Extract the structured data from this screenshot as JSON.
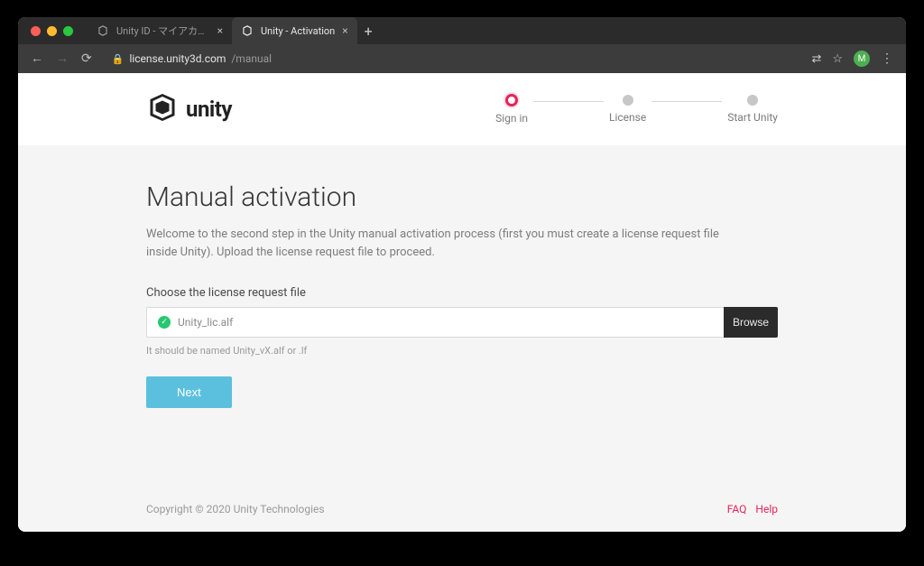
{
  "browser": {
    "tabs": [
      {
        "label": "Unity ID - マイアカウント設定",
        "active": false
      },
      {
        "label": "Unity - Activation",
        "active": true
      }
    ],
    "url_host": "license.unity3d.com",
    "url_path": "/manual",
    "avatar_initial": "M"
  },
  "header": {
    "brand": "unity",
    "steps": [
      {
        "label": "Sign in",
        "active": true
      },
      {
        "label": "License",
        "active": false
      },
      {
        "label": "Start Unity",
        "active": false
      }
    ]
  },
  "main": {
    "title": "Manual activation",
    "description": "Welcome to the second step in the Unity manual activation process (first you must create a license request file inside Unity). Upload the license request file to proceed.",
    "field_label": "Choose the license request file",
    "file_name": "Unity_lic.alf",
    "browse_label": "Browse",
    "hint": "It should be named Unity_vX.alf or .lf",
    "next_label": "Next"
  },
  "footer": {
    "copyright": "Copyright © 2020 Unity Technologies",
    "links": {
      "faq": "FAQ",
      "help": "Help"
    }
  }
}
